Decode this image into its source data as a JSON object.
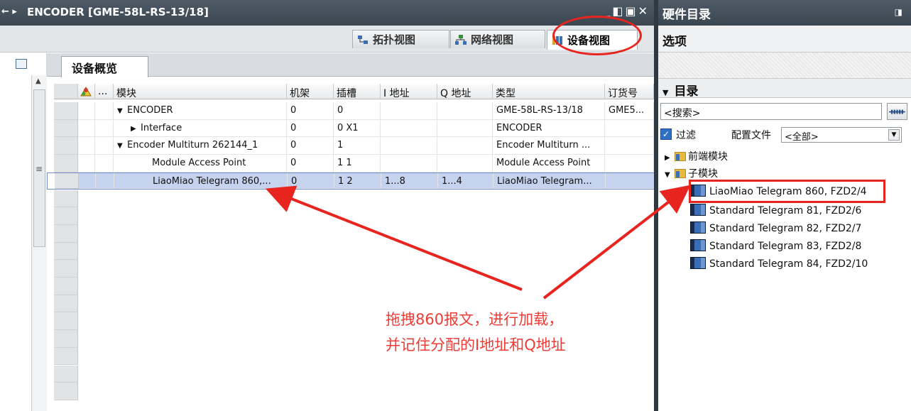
{
  "editor": {
    "title": "ENCODER [GME-58L-RS-13/18]",
    "view_tabs": [
      "拓扑视图",
      "网络视图",
      "设备视图"
    ],
    "overview_tab": "设备概览"
  },
  "table": {
    "columns": [
      "模块",
      "机架",
      "插槽",
      "I 地址",
      "Q 地址",
      "类型",
      "订货号"
    ],
    "rows": [
      {
        "module": "ENCODER",
        "rack": "0",
        "slot": "0",
        "i_addr": "",
        "q_addr": "",
        "type": "GME-58L-RS-13/18",
        "order": "GME5..."
      },
      {
        "module": "Interface",
        "rack": "0",
        "slot": "0 X1",
        "i_addr": "",
        "q_addr": "",
        "type": "ENCODER",
        "order": ""
      },
      {
        "module": "Encoder Multiturn 262144_1",
        "rack": "0",
        "slot": "1",
        "i_addr": "",
        "q_addr": "",
        "type": "Encoder Multiturn ...",
        "order": ""
      },
      {
        "module": "Module Access Point",
        "rack": "0",
        "slot": "1 1",
        "i_addr": "",
        "q_addr": "",
        "type": "Module Access Point",
        "order": ""
      },
      {
        "module": "LiaoMiao Telegram 860,...",
        "rack": "0",
        "slot": "1 2",
        "i_addr": "1...8",
        "q_addr": "1...4",
        "type": "LiaoMiao Telegram...",
        "order": ""
      }
    ]
  },
  "catalog": {
    "title": "硬件目录",
    "options": "选项",
    "directory": "目录",
    "search_placeholder": "<搜索>",
    "filter_label": "过滤",
    "profile_label": "配置文件",
    "profile_value": "<全部>",
    "folders": [
      "前端模块",
      "子模块"
    ],
    "items": [
      "LiaoMiao Telegram 860, FZD2/4",
      "Standard Telegram 81, FZD2/6",
      "Standard Telegram 82, FZD2/7",
      "Standard Telegram 83, FZD2/8",
      "Standard Telegram 84, FZD2/10"
    ]
  },
  "annotation": {
    "line1": "拖拽860报文，进行加载，",
    "line2": "并记住分配的I地址和Q地址"
  },
  "colors": {
    "annotation_red": "#e8241f",
    "selected_row": "#c5d3ee",
    "titlebar": "#3f4b55"
  }
}
